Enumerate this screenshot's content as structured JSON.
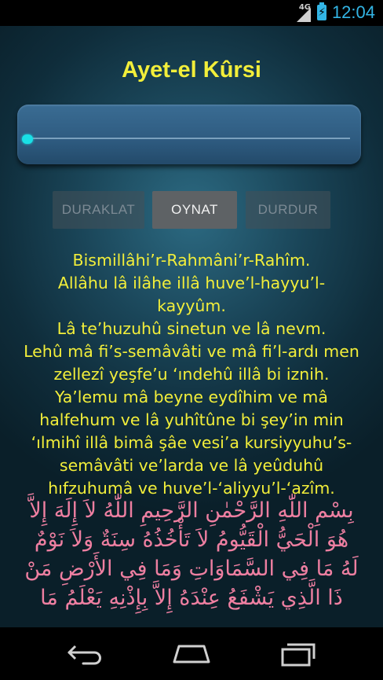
{
  "status_bar": {
    "network": "4G",
    "time": "12:04",
    "icons": [
      "signal-icon",
      "battery-charging-icon"
    ]
  },
  "app": {
    "title": "Ayet-el Kûrsi",
    "progress": 0.0,
    "buttons": {
      "pause": "DURAKLAT",
      "play": "OYNAT",
      "stop": "DURDUR"
    },
    "latin_lines": [
      "Bismillâhi’r-Rahmâni’r-Rahîm.",
      "Allâhu lâ ilâhe illâ huve’l-hayyu’l-",
      "kayyûm.",
      "Lâ te’huzuhû sinetun ve lâ nevm.",
      "Lehû mâ fi’s-semâvâti ve mâ fi’l-ardı men",
      "zellezî yeşfe’u ‘ındehû illâ bi iznih.",
      "Ya’lemu mâ beyne eydîhim ve mâ",
      "halfehum ve lâ yuhîtûne bi şey’in min",
      "‘ılmihî illâ bimâ şâe vesi’a kursiyyuhu’s-",
      "semâvâti ve’larda ve lâ yeûduhû",
      "hıfzuhumâ ve huve’l-‘aliyyu’l-‘azîm."
    ],
    "arabic_lines": [
      "بِسْمِ اللّٰهِ الرَّحْمٰنِ الرَّحِيمِ اللّٰهُ لاَ إِلَهَ إِلاَّ",
      "هُوَ الْحَيُّ الْقَيُّومُ لاَ تَأْخُذُهُ سِنَةٌ وَلاَ نَوْمٌ",
      "لَهُ مَا فِي السَّمَاوَاتِ وَمَا فِي الأَرْضِ مَنْ",
      "ذَا الَّذِي يَشْفَعُ عِنْدَهُ إِلاَّ بِإِذْنِهِ يَعْلَمُ مَا"
    ]
  },
  "nav_bar": {
    "icons": [
      "back-icon",
      "home-icon",
      "recent-apps-icon"
    ]
  },
  "colors": {
    "title": "#f2ee3a",
    "latin_text": "#f2ee3a",
    "arabic_text": "#ee7fa1",
    "accent": "#33b5e5",
    "seek_thumb": "#19e0e6"
  }
}
